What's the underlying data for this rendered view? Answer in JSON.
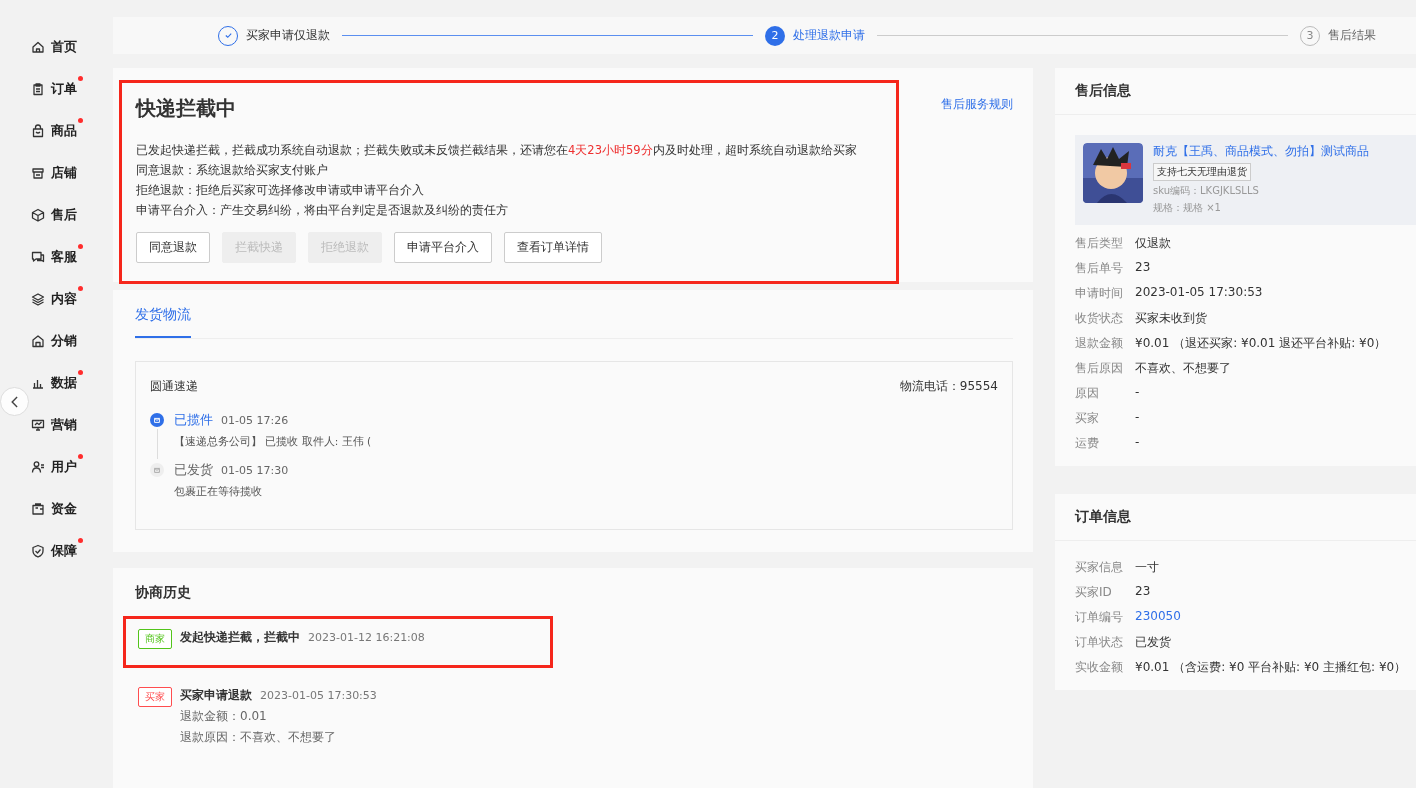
{
  "sidebar": {
    "items": [
      {
        "label": "首页",
        "dot": false
      },
      {
        "label": "订单",
        "dot": true
      },
      {
        "label": "商品",
        "dot": true
      },
      {
        "label": "店铺",
        "dot": false
      },
      {
        "label": "售后",
        "dot": false
      },
      {
        "label": "客服",
        "dot": true
      },
      {
        "label": "内容",
        "dot": true
      },
      {
        "label": "分销",
        "dot": false
      },
      {
        "label": "数据",
        "dot": true
      },
      {
        "label": "营销",
        "dot": false
      },
      {
        "label": "用户",
        "dot": true
      },
      {
        "label": "资金",
        "dot": false
      },
      {
        "label": "保障",
        "dot": true
      }
    ]
  },
  "steps": [
    {
      "label": "买家申请仅退款",
      "done": true,
      "selected": false
    },
    {
      "number": "2",
      "label": "处理退款申请",
      "done": false,
      "selected": true
    },
    {
      "number": "3",
      "label": "售后结果",
      "done": false,
      "selected": false
    }
  ],
  "intercept": {
    "title": "快递拦截中",
    "highlighted": true,
    "rules_link": "售后服务规则",
    "lines": [
      [
        {
          "text": "已发起快递拦截，拦截成功系统自动退款；拦截失败或未反馈拦截结果，还请您在",
          "kind": "normal"
        },
        {
          "text": "4天23小时59分",
          "kind": "alert"
        },
        {
          "text": "内及时处理，超时系统自动退款给买家",
          "kind": "normal"
        }
      ],
      [
        {
          "text": "同意退款：系统退款给买家支付账户",
          "kind": "normal"
        }
      ],
      [
        {
          "text": "拒绝退款：拒绝后买家可选择修改申请或申请平台介入",
          "kind": "normal"
        }
      ],
      [
        {
          "text": "申请平台介入：产生交易纠纷，将由平台判定是否退款及纠纷的责任方",
          "kind": "normal"
        }
      ]
    ],
    "buttons": [
      {
        "label": "同意退款",
        "disabled": false
      },
      {
        "label": "拦截快递",
        "disabled": true
      },
      {
        "label": "拒绝退款",
        "disabled": true
      },
      {
        "label": "申请平台介入",
        "disabled": false
      },
      {
        "label": "查看订单详情",
        "disabled": false
      }
    ]
  },
  "logistics": {
    "tab": "发货物流",
    "carrier": "圆通速递",
    "phone": "物流电话：95554",
    "events": [
      {
        "status": "已揽件",
        "time": "01-05 17:26",
        "detail": "【速递总务公司】 已揽收 取件人: 王伟 (",
        "current": true
      },
      {
        "status": "已发货",
        "time": "01-05 17:30",
        "detail": "包裹正在等待揽收",
        "current": false
      }
    ]
  },
  "history": {
    "title": "协商历史",
    "entries": [
      {
        "role": "商家",
        "color": "#52c41a",
        "title": "发起快递拦截，拦截中",
        "time": "2023-01-12 16:21:08",
        "highlighted": true
      },
      {
        "role": "买家",
        "color": "#ff4d4f",
        "title": "买家申请退款",
        "time": "2023-01-05 17:30:53",
        "details": [
          "退款金额：0.01",
          "退款原因：不喜欢、不想要了"
        ],
        "highlighted": false
      }
    ]
  },
  "after_sale": {
    "title": "售后信息",
    "product": {
      "kind": "picture",
      "name": "耐克【王禹、商品模式、勿拍】测试商品",
      "tag": "支持七天无理由退货",
      "sku": "sku编码：LKGJKLSLLS",
      "spec": "规格：规格 ×1"
    },
    "fields": [
      {
        "label": "售后类型",
        "value": "仅退款"
      },
      {
        "label": "售后单号",
        "value": "23"
      },
      {
        "label": "申请时间",
        "value": "2023-01-05 17:30:53"
      },
      {
        "label": "收货状态",
        "value": "买家未收到货"
      },
      {
        "label": "退款金额",
        "value": "¥0.01 （退还买家: ¥0.01 退还平台补贴: ¥0）"
      },
      {
        "label": "售后原因",
        "value": "不喜欢、不想要了"
      },
      {
        "label": "原因",
        "value": "-"
      },
      {
        "label": "买家",
        "value": "-"
      },
      {
        "label": "运费",
        "value": "-"
      }
    ]
  },
  "order": {
    "title": "订单信息",
    "fields": [
      {
        "label": "买家信息",
        "value": "一寸",
        "link": false
      },
      {
        "label": "买家ID",
        "value": "23",
        "link": false
      },
      {
        "label": "订单编号",
        "value": "230050",
        "link": true
      },
      {
        "label": "订单状态",
        "value": "已发货",
        "link": false
      },
      {
        "label": "实收金额",
        "value": "¥0.01 （含运费: ¥0 平台补贴: ¥0 主播红包: ¥0）",
        "link": false
      }
    ]
  }
}
